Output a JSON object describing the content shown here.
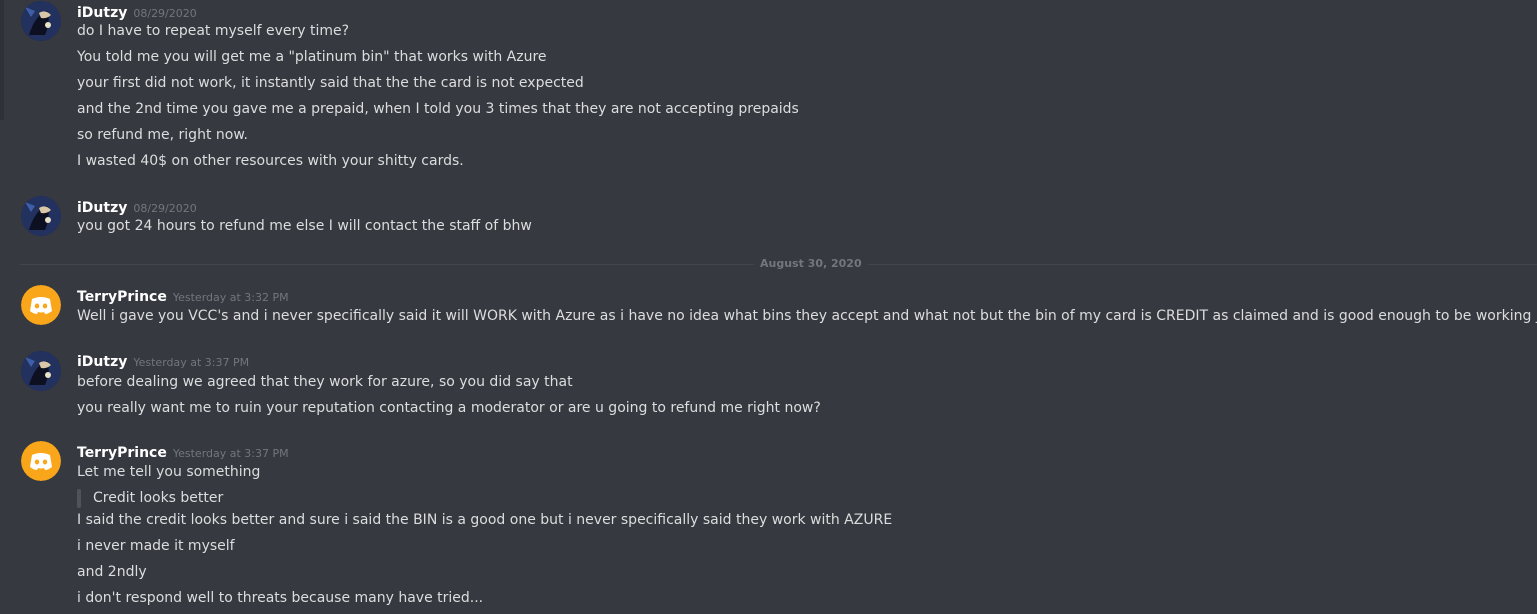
{
  "colors": {
    "background": "#36393f",
    "username": "#ffffff",
    "message_text": "#dcddde",
    "timestamp": "#72767d",
    "discord_avatar_bg": "#faa61a"
  },
  "divider": {
    "label": "August 30, 2020"
  },
  "groups": [
    {
      "username": "iDutzy",
      "timestamp": "08/29/2020",
      "avatar": "idutzy-avatar",
      "lines": [
        "do I have to repeat myself every time?",
        "You told me you will get me a \"platinum bin\" that works with Azure",
        "your first did not work, it instantly said that the the card is not expected",
        "and the 2nd time you gave me a prepaid, when I told you 3 times that they are not accepting prepaids",
        "so refund me, right now.",
        "I wasted 40$ on other resources with your shitty cards."
      ]
    },
    {
      "username": "iDutzy",
      "timestamp": "08/29/2020",
      "avatar": "idutzy-avatar",
      "lines": [
        "you got 24 hours to refund me else I will contact the staff of bhw"
      ]
    },
    {
      "username": "TerryPrince",
      "timestamp": "Yesterday at 3:32 PM",
      "avatar": "discord-default-avatar",
      "lines": [
        "Well i gave you VCC's and i never specifically said it will WORK with Azure as i have no idea what bins they accept and what not but the bin of my card is CREDIT as claimed and is good enough to be working just fine"
      ]
    },
    {
      "username": "iDutzy",
      "timestamp": "Yesterday at 3:37 PM",
      "avatar": "idutzy-avatar",
      "lines": [
        "before dealing we agreed that they work for azure, so you did say that",
        "you really want me to ruin your reputation contacting a moderator or are u going to refund me right now?"
      ]
    },
    {
      "username": "TerryPrince",
      "timestamp": "Yesterday at 3:37 PM",
      "avatar": "discord-default-avatar",
      "lines": [
        "Let me tell you something"
      ],
      "quote": "Credit looks better",
      "lines_after": [
        "I said the credit looks better and sure i said the BIN is a good one but i never specifically said they work with AZURE",
        "i never made it myself",
        "and 2ndly",
        "i don't respond well to threats because many have tried..."
      ]
    }
  ]
}
